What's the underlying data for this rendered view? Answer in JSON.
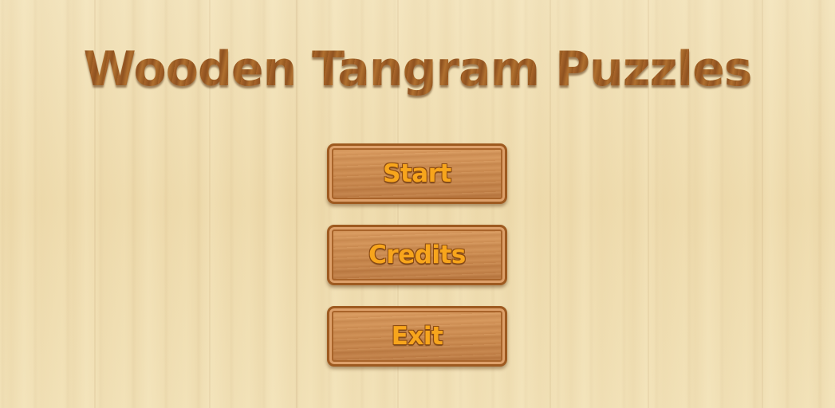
{
  "title": "Wooden Tangram Puzzles",
  "menu": {
    "start_label": "Start",
    "credits_label": "Credits",
    "exit_label": "Exit"
  },
  "colors": {
    "background_wood": "#f0dfb4",
    "title_brown": "#9a5a24",
    "button_wood": "#cb8a4f",
    "button_border": "#9e5a20",
    "button_text": "#f7a51c"
  }
}
